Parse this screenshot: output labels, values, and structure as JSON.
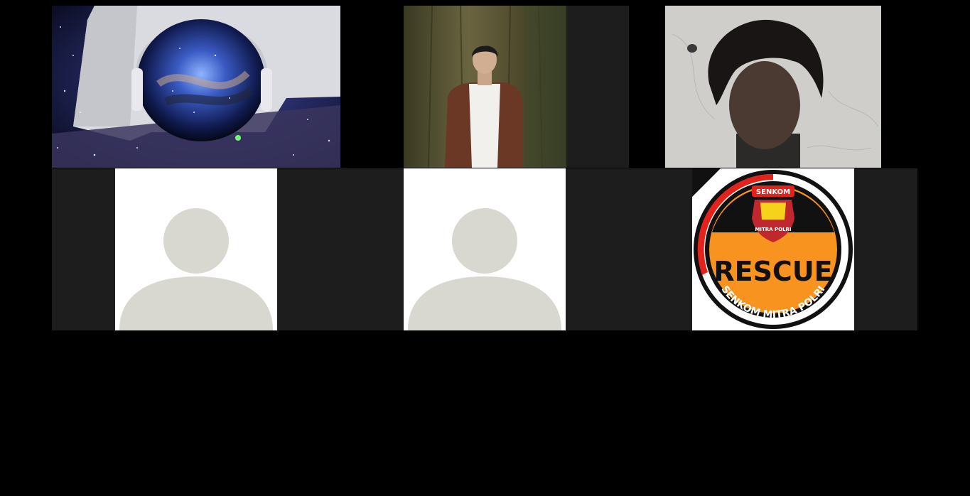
{
  "meeting": {
    "participants": [
      {
        "id": "p1",
        "video": "galaxy-headphones-image"
      },
      {
        "id": "p2",
        "video": "man-in-forest-image"
      },
      {
        "id": "p3",
        "video": "webcam-face-image"
      },
      {
        "id": "p4",
        "video": "default-avatar"
      },
      {
        "id": "p5",
        "video": "default-avatar"
      },
      {
        "id": "p6",
        "video": "rescue-logo",
        "logo": {
          "top_text": "SENKOM",
          "badge_text": "MITRA POLRI",
          "main_text": "RESCUE",
          "ring_text": "SENKOM MITRA POLRI"
        }
      }
    ]
  },
  "colors": {
    "page_background": "#000000",
    "tile_background": "#1d1d1d",
    "avatar_fill": "#d8d8d0",
    "logo_orange": "#f7931e",
    "logo_red": "#e3221b",
    "logo_black": "#111111"
  }
}
